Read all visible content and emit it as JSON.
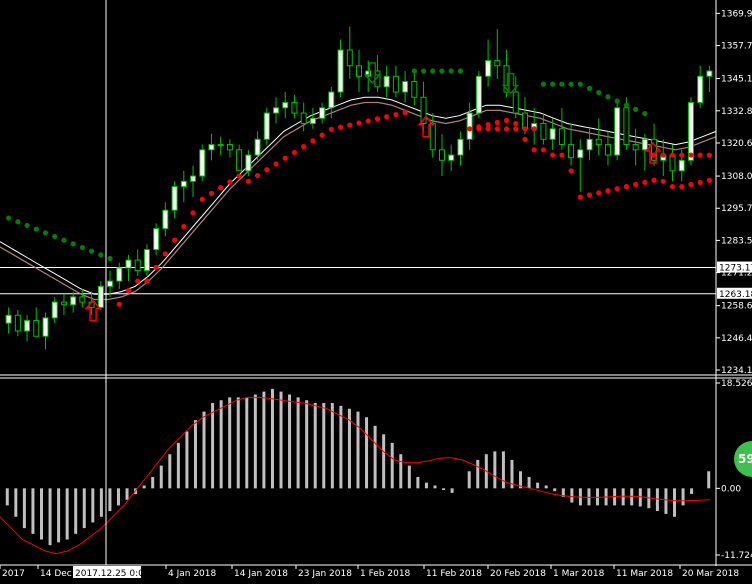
{
  "colors": {
    "background": "#000000",
    "bull_candle": "#ffffff",
    "bear_candle": "#00c000",
    "wick": "#00c000",
    "stop_up": "#ff0000",
    "stop_down": "#008000",
    "ma": "#c0a0a0",
    "macd_hist": "#c0c0c0",
    "macd_signal": "#ff0000",
    "grid": "#ffffff",
    "badge": "#3fbf4f"
  },
  "badge_text": "59",
  "crosshair_label": "2017.12.25 0:00",
  "chart_data": [
    {
      "type": "candlestick",
      "title": "",
      "ylim": [
        1234.15,
        1372.0
      ],
      "y_ticks": [
        "1369.95",
        "1357.70",
        "1345.15",
        "1332.85",
        "1320.60",
        "1308.00",
        "1295.75",
        "1283.50",
        "1271.25",
        "1258.65",
        "1246.40",
        "1234.15"
      ],
      "h_lines": [
        {
          "label": "1273.17",
          "value": 1273.17
        },
        {
          "label": "1263.18",
          "value": 1263.18
        }
      ],
      "x_labels": [
        "2017",
        "14 Dec 2017",
        "2017.12.25 0:00",
        "4 Jan 2018",
        "14 Jan 2018",
        "23 Jan 2018",
        "1 Feb 2018",
        "11 Feb 2018",
        "20 Feb 2018",
        "1 Mar 2018",
        "11 Mar 2018",
        "20 Mar 2018"
      ],
      "candles": [
        [
          1252,
          1258,
          1248,
          1255
        ],
        [
          1255,
          1257,
          1247,
          1249
        ],
        [
          1249,
          1255,
          1245,
          1253
        ],
        [
          1253,
          1258,
          1250,
          1247
        ],
        [
          1247,
          1256,
          1242,
          1254
        ],
        [
          1254,
          1262,
          1252,
          1260
        ],
        [
          1260,
          1263,
          1255,
          1259
        ],
        [
          1259,
          1264,
          1256,
          1262
        ],
        [
          1262,
          1265,
          1258,
          1260
        ],
        [
          1260,
          1264,
          1255,
          1258
        ],
        [
          1258,
          1268,
          1257,
          1266
        ],
        [
          1266,
          1272,
          1262,
          1268
        ],
        [
          1268,
          1275,
          1265,
          1273
        ],
        [
          1273,
          1278,
          1268,
          1276
        ],
        [
          1276,
          1280,
          1270,
          1272
        ],
        [
          1272,
          1282,
          1270,
          1280
        ],
        [
          1280,
          1290,
          1278,
          1288
        ],
        [
          1288,
          1298,
          1285,
          1295
        ],
        [
          1295,
          1306,
          1292,
          1304
        ],
        [
          1304,
          1310,
          1298,
          1306
        ],
        [
          1306,
          1312,
          1300,
          1308
        ],
        [
          1308,
          1320,
          1306,
          1318
        ],
        [
          1318,
          1324,
          1314,
          1320
        ],
        [
          1320,
          1323,
          1316,
          1320
        ],
        [
          1320,
          1322,
          1315,
          1318
        ],
        [
          1318,
          1320,
          1310,
          1310
        ],
        [
          1310,
          1318,
          1308,
          1316
        ],
        [
          1316,
          1325,
          1314,
          1322
        ],
        [
          1322,
          1334,
          1320,
          1332
        ],
        [
          1332,
          1338,
          1328,
          1334
        ],
        [
          1334,
          1340,
          1330,
          1336
        ],
        [
          1336,
          1339,
          1330,
          1332
        ],
        [
          1332,
          1336,
          1325,
          1328
        ],
        [
          1328,
          1334,
          1326,
          1330
        ],
        [
          1330,
          1336,
          1328,
          1334
        ],
        [
          1334,
          1342,
          1330,
          1340
        ],
        [
          1340,
          1360,
          1338,
          1356
        ],
        [
          1356,
          1365,
          1345,
          1350
        ],
        [
          1350,
          1356,
          1340,
          1346
        ],
        [
          1346,
          1352,
          1340,
          1348
        ],
        [
          1348,
          1354,
          1340,
          1342
        ],
        [
          1342,
          1350,
          1338,
          1346
        ],
        [
          1346,
          1350,
          1338,
          1340
        ],
        [
          1340,
          1348,
          1336,
          1344
        ],
        [
          1344,
          1348,
          1335,
          1338
        ],
        [
          1338,
          1344,
          1325,
          1328
        ],
        [
          1328,
          1332,
          1315,
          1318
        ],
        [
          1318,
          1324,
          1308,
          1314
        ],
        [
          1314,
          1320,
          1310,
          1316
        ],
        [
          1316,
          1325,
          1312,
          1322
        ],
        [
          1322,
          1336,
          1318,
          1332
        ],
        [
          1332,
          1348,
          1330,
          1346
        ],
        [
          1346,
          1360,
          1342,
          1352
        ],
        [
          1352,
          1364,
          1345,
          1350
        ],
        [
          1350,
          1356,
          1338,
          1340
        ],
        [
          1340,
          1346,
          1330,
          1332
        ],
        [
          1332,
          1338,
          1324,
          1326
        ],
        [
          1326,
          1334,
          1320,
          1328
        ],
        [
          1328,
          1332,
          1320,
          1322
        ],
        [
          1322,
          1330,
          1318,
          1326
        ],
        [
          1326,
          1334,
          1318,
          1320
        ],
        [
          1320,
          1328,
          1312,
          1315
        ],
        [
          1315,
          1322,
          1302,
          1318
        ],
        [
          1318,
          1326,
          1314,
          1322
        ],
        [
          1322,
          1330,
          1316,
          1320
        ],
        [
          1320,
          1325,
          1312,
          1316
        ],
        [
          1316,
          1336,
          1314,
          1334
        ],
        [
          1334,
          1338,
          1318,
          1320
        ],
        [
          1320,
          1326,
          1312,
          1318
        ],
        [
          1318,
          1324,
          1310,
          1322
        ],
        [
          1322,
          1328,
          1312,
          1314
        ],
        [
          1314,
          1322,
          1308,
          1316
        ],
        [
          1316,
          1320,
          1306,
          1310
        ],
        [
          1310,
          1318,
          1306,
          1314
        ],
        [
          1314,
          1338,
          1312,
          1336
        ],
        [
          1336,
          1350,
          1334,
          1346
        ],
        [
          1346,
          1350,
          1340,
          1348
        ]
      ],
      "ma_fast": [
        1283,
        1280,
        1277,
        1274,
        1271,
        1268,
        1265,
        1263,
        1263,
        1264,
        1266,
        1270,
        1275,
        1281,
        1287,
        1293,
        1299,
        1305,
        1310,
        1315,
        1320,
        1325,
        1328,
        1331,
        1333,
        1335,
        1337,
        1338,
        1338,
        1337,
        1335,
        1333,
        1331,
        1330,
        1331,
        1333,
        1335,
        1335,
        1334,
        1333,
        1332,
        1330,
        1328,
        1327,
        1326,
        1325,
        1324,
        1323,
        1322,
        1321,
        1320,
        1321,
        1323,
        1325
      ],
      "ma_slow": [
        1281,
        1278,
        1275,
        1272,
        1269,
        1266,
        1263,
        1261,
        1261,
        1262,
        1264,
        1268,
        1273,
        1279,
        1285,
        1291,
        1297,
        1303,
        1308,
        1313,
        1318,
        1323,
        1326,
        1329,
        1331,
        1333,
        1335,
        1336,
        1336,
        1335,
        1333,
        1331,
        1329,
        1328,
        1329,
        1331,
        1333,
        1333,
        1332,
        1331,
        1330,
        1328,
        1326,
        1325,
        1324,
        1323,
        1322,
        1321,
        1320,
        1319,
        1318,
        1319,
        1321,
        1323
      ],
      "stop_down_dots": [
        {
          "x": 0,
          "y": 1292.5
        },
        {
          "x": 0.05,
          "y": 1292
        },
        {
          "x": 0.08,
          "y": 1287
        },
        {
          "x": 0.11,
          "y": 1281
        },
        {
          "x": 0.13,
          "y": 1276
        }
      ],
      "markers": [
        {
          "kind": "arrow-up",
          "color": "red",
          "at": [
            0.13,
            1256
          ]
        },
        {
          "kind": "arrow-down",
          "color": "green",
          "at": [
            0.52,
            1348
          ]
        },
        {
          "kind": "arrow-up",
          "color": "red",
          "at": [
            0.595,
            1326
          ]
        },
        {
          "kind": "arrow-down",
          "color": "green",
          "at": [
            0.713,
            1344
          ]
        },
        {
          "kind": "arrow-up",
          "color": "red",
          "at": [
            0.912,
            1316
          ]
        }
      ]
    },
    {
      "type": "bar",
      "title": "",
      "ylim": [
        -11.724,
        18.526
      ],
      "y_ticks": [
        "18.526",
        "0.00",
        "-11.724"
      ],
      "histogram": [
        -3,
        -5,
        -7,
        -8,
        -9,
        -10,
        -9.5,
        -9,
        -8,
        -7,
        -6,
        -5,
        -4,
        -3,
        -2,
        -1,
        0.5,
        2,
        4,
        6,
        8,
        10,
        12,
        13.5,
        15,
        15.5,
        16,
        16,
        16,
        16.5,
        17,
        17.5,
        17,
        16.5,
        16,
        15.5,
        15,
        15,
        15,
        14.5,
        14,
        13.5,
        12.5,
        11,
        9.5,
        8,
        6,
        4,
        2,
        1,
        0.5,
        -0.3,
        -0.8,
        0,
        3,
        5,
        6,
        6.5,
        6.5,
        5,
        3,
        2,
        1,
        0.5,
        -0.5,
        -1.5,
        -2.5,
        -3,
        -3,
        -3,
        -3,
        -3,
        -3,
        -3,
        -3.2,
        -3.5,
        -4,
        -4.5,
        -5,
        -3,
        -1,
        0,
        3
      ],
      "signal": [
        -5,
        -7,
        -9,
        -10,
        -11,
        -11.5,
        -11,
        -10,
        -8.5,
        -7,
        -5,
        -3,
        -0.5,
        2,
        4.5,
        7,
        9,
        11,
        12.5,
        13.5,
        14.5,
        15.5,
        16,
        16,
        15.8,
        15.5,
        15.2,
        15,
        14.5,
        14,
        13,
        12,
        10.5,
        8.5,
        6.5,
        5,
        4.5,
        4.5,
        4.8,
        5.3,
        5.4,
        5,
        4.2,
        3.2,
        2,
        1,
        0.5,
        0,
        -0.5,
        -1,
        -1.3,
        -1.5,
        -1.6,
        -1.6,
        -1.5,
        -1.4,
        -1.4,
        -1.5,
        -1.8,
        -2,
        -2.2,
        -2.2,
        -2.1,
        -2
      ]
    }
  ]
}
